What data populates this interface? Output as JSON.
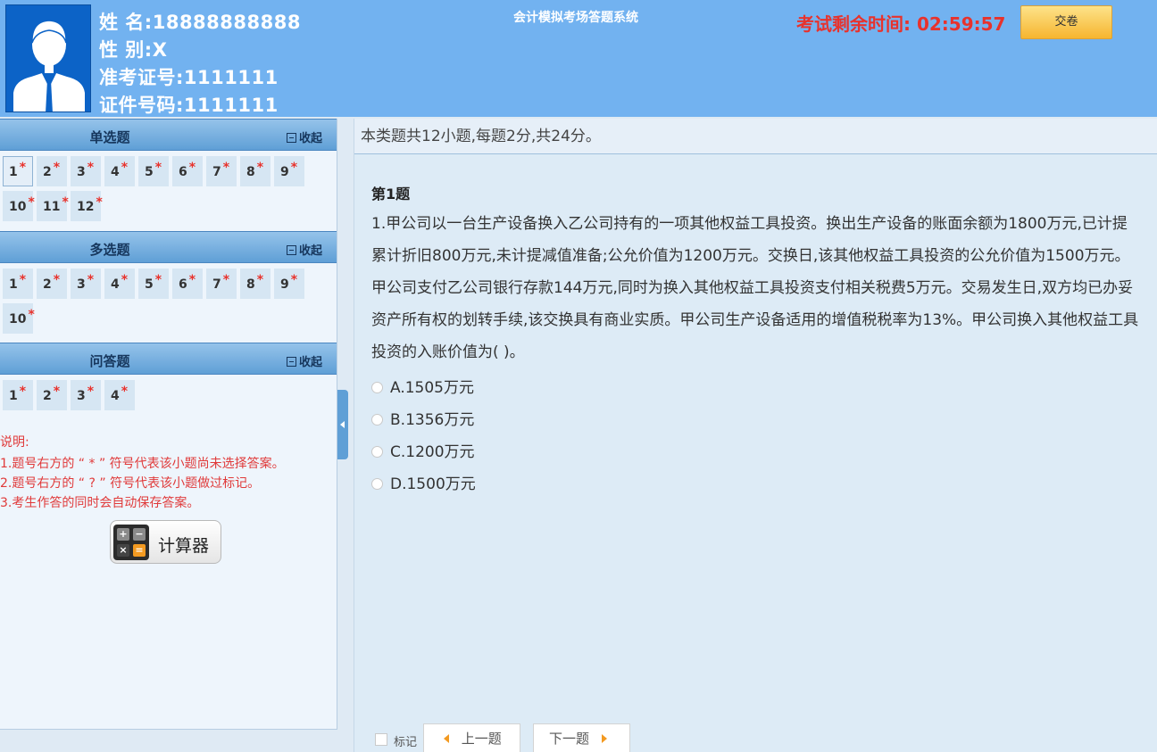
{
  "header": {
    "system_title": "会计模拟考场答题系统",
    "timer_label": "考试剩余时间:",
    "timer_value": "02:59:57",
    "submit_label": "交卷"
  },
  "candidate": {
    "name_label": "姓 名:",
    "name_value": "18888888888",
    "gender_label": "性 别:",
    "gender_value": "X",
    "exam_id_label": "准考证号:",
    "exam_id_value": "1111111",
    "cert_id_label": "证件号码:",
    "cert_id_value": "1111111"
  },
  "sidebar": {
    "collapse_label": "收起",
    "star": "*",
    "sections": [
      {
        "title": "单选题",
        "numbers": [
          "1",
          "2",
          "3",
          "4",
          "5",
          "6",
          "7",
          "8",
          "9",
          "10",
          "11",
          "12"
        ]
      },
      {
        "title": "多选题",
        "numbers": [
          "1",
          "2",
          "3",
          "4",
          "5",
          "6",
          "7",
          "8",
          "9",
          "10"
        ]
      },
      {
        "title": "问答题",
        "numbers": [
          "1",
          "2",
          "3",
          "4"
        ]
      }
    ],
    "notes": [
      "说明:",
      "1.题号右方的 “ * ” 符号代表该小题尚未选择答案。",
      "2.题号右方的 “ ? ” 符号代表该小题做过标记。",
      "3.考生作答的同时会自动保存答案。"
    ],
    "calculator_label": "计算器",
    "calculator_keys": [
      "+",
      "−",
      "×",
      "="
    ]
  },
  "main": {
    "section_info": "本类题共12小题,每题2分,共24分。",
    "question_title": "第1题",
    "question_stem": "1.甲公司以一台生产设备换入乙公司持有的一项其他权益工具投资。换出生产设备的账面余额为1800万元,已计提累计折旧800万元,未计提减值准备;公允价值为1200万元。交换日,该其他权益工具投资的公允价值为1500万元。甲公司支付乙公司银行存款144万元,同时为换入其他权益工具投资支付相关税费5万元。交易发生日,双方均已办妥资产所有权的划转手续,该交换具有商业实质。甲公司生产设备适用的增值税税率为13%。甲公司换入其他权益工具投资的入账价值为(  )。",
    "options": [
      "A.1505万元",
      "B.1356万元",
      "C.1200万元",
      "D.1500万元"
    ],
    "mark_label": "标记",
    "prev_label": "上一题",
    "next_label": "下一题"
  },
  "colors": {
    "header_bg": "#72b2f0",
    "timer": "#e8322c",
    "submit_btn": "#f6b52f",
    "section_header": "#5f9fd6",
    "note_text": "#e03a3a"
  }
}
